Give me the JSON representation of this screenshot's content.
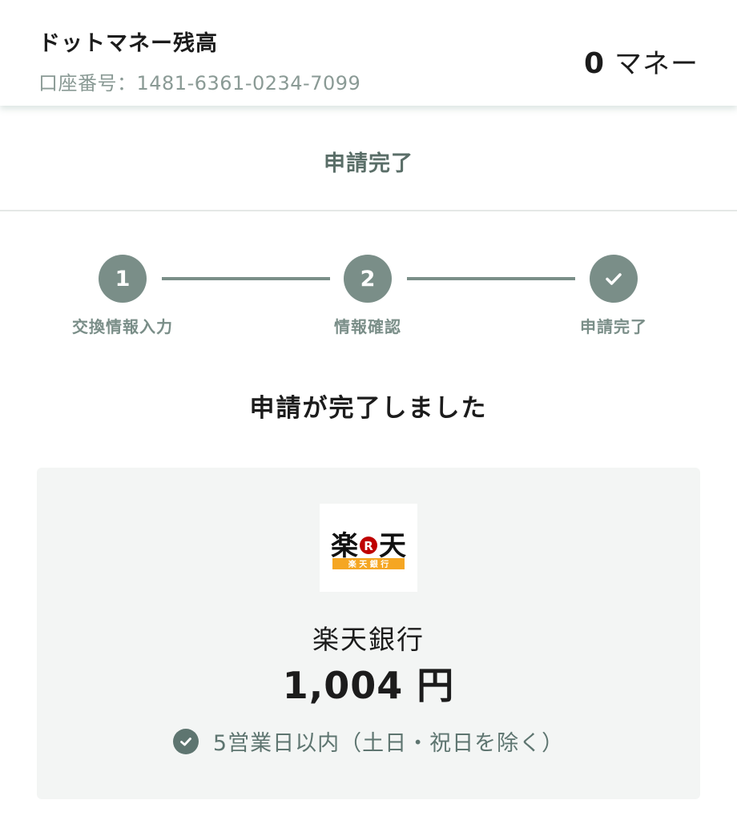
{
  "header": {
    "title": "ドットマネー残高",
    "account_number": "口座番号：1481-6361-0234-7099",
    "balance_value": "0",
    "balance_unit": "マネー"
  },
  "page": {
    "title": "申請完了"
  },
  "stepper": {
    "steps": [
      {
        "number": "1",
        "label": "交換情報入力",
        "state": "done"
      },
      {
        "number": "2",
        "label": "情報確認",
        "state": "done"
      },
      {
        "number": "",
        "label": "申請完了",
        "state": "complete",
        "icon": "check-icon"
      }
    ],
    "color": "#7a8e88"
  },
  "main": {
    "heading": "申請が完了しました",
    "card": {
      "logo": {
        "text": "楽天",
        "mark": "R",
        "subtitle": "楽 天 銀 行",
        "brand_color": "#bf0000",
        "band_color": "#f5a623"
      },
      "bank_name": "楽天銀行",
      "amount": "1,004 円",
      "eta_icon": "check-circle-icon",
      "eta_text": "5営業日以内（土日・祝日を除く）"
    }
  }
}
